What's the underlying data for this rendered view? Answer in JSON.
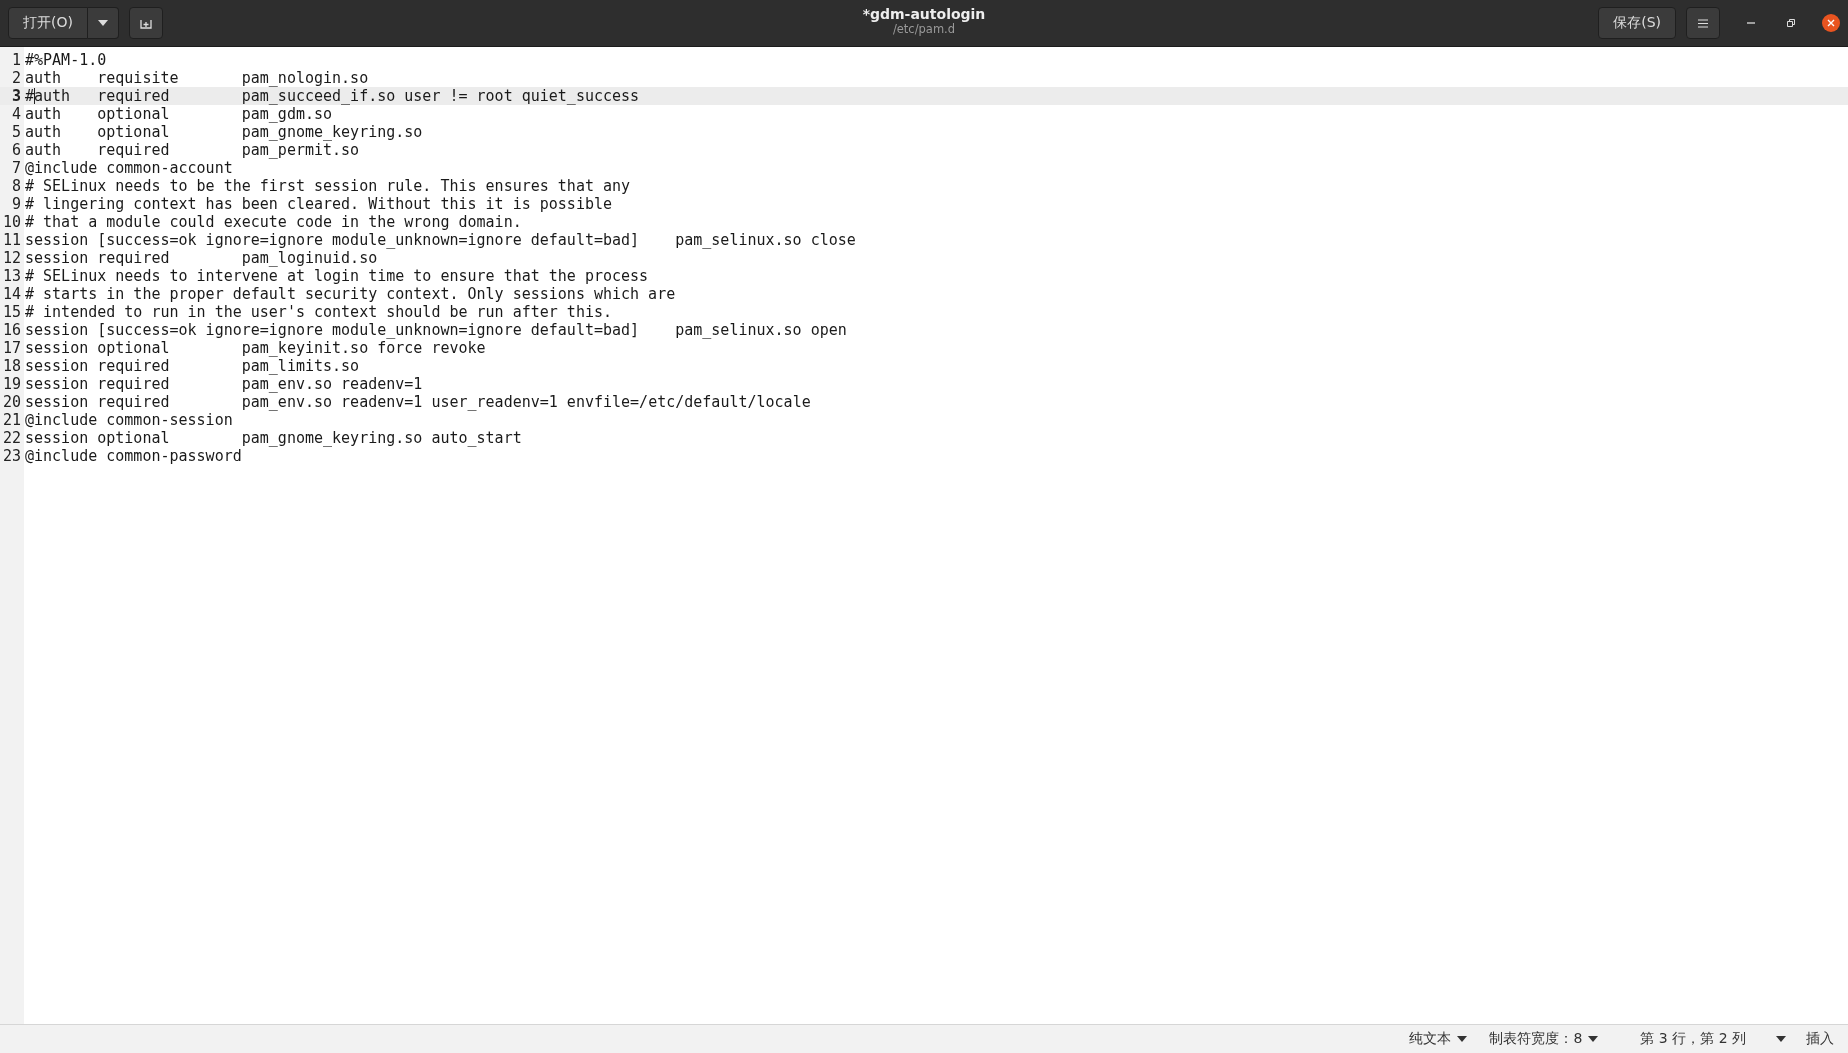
{
  "header": {
    "open_button": "打开(O)",
    "title": "*gdm-autologin",
    "subtitle": "/etc/pam.d",
    "save_button": "保存(S)"
  },
  "editor": {
    "lines": [
      {
        "number": "1",
        "text": "#%PAM-1.0",
        "current": false
      },
      {
        "number": "2",
        "text": "auth\trequisite\tpam_nologin.so",
        "current": false
      },
      {
        "number": "3",
        "text": "#auth\trequired\tpam_succeed_if.so user != root quiet_success",
        "current": true
      },
      {
        "number": "4",
        "text": "auth\toptional\tpam_gdm.so",
        "current": false
      },
      {
        "number": "5",
        "text": "auth\toptional\tpam_gnome_keyring.so",
        "current": false
      },
      {
        "number": "6",
        "text": "auth\trequired\tpam_permit.so",
        "current": false
      },
      {
        "number": "7",
        "text": "@include common-account",
        "current": false
      },
      {
        "number": "8",
        "text": "# SELinux needs to be the first session rule. This ensures that any",
        "current": false
      },
      {
        "number": "9",
        "text": "# lingering context has been cleared. Without this it is possible",
        "current": false
      },
      {
        "number": "10",
        "text": "# that a module could execute code in the wrong domain.",
        "current": false
      },
      {
        "number": "11",
        "text": "session [success=ok ignore=ignore module_unknown=ignore default=bad]\tpam_selinux.so close",
        "current": false
      },
      {
        "number": "12",
        "text": "session required\tpam_loginuid.so",
        "current": false
      },
      {
        "number": "13",
        "text": "# SELinux needs to intervene at login time to ensure that the process",
        "current": false
      },
      {
        "number": "14",
        "text": "# starts in the proper default security context. Only sessions which are",
        "current": false
      },
      {
        "number": "15",
        "text": "# intended to run in the user's context should be run after this.",
        "current": false
      },
      {
        "number": "16",
        "text": "session [success=ok ignore=ignore module_unknown=ignore default=bad]\tpam_selinux.so open",
        "current": false
      },
      {
        "number": "17",
        "text": "session optional\tpam_keyinit.so force revoke",
        "current": false
      },
      {
        "number": "18",
        "text": "session required\tpam_limits.so",
        "current": false
      },
      {
        "number": "19",
        "text": "session required\tpam_env.so readenv=1",
        "current": false
      },
      {
        "number": "20",
        "text": "session required\tpam_env.so readenv=1 user_readenv=1 envfile=/etc/default/locale",
        "current": false
      },
      {
        "number": "21",
        "text": "@include common-session",
        "current": false
      },
      {
        "number": "22",
        "text": "session optional\tpam_gnome_keyring.so auto_start",
        "current": false
      },
      {
        "number": "23",
        "text": "@include common-password",
        "current": false
      }
    ]
  },
  "status_bar": {
    "language": "纯文本",
    "tab_width": "制表符宽度：8",
    "position": "第 3 行，第 2 列",
    "mode": "插入"
  }
}
